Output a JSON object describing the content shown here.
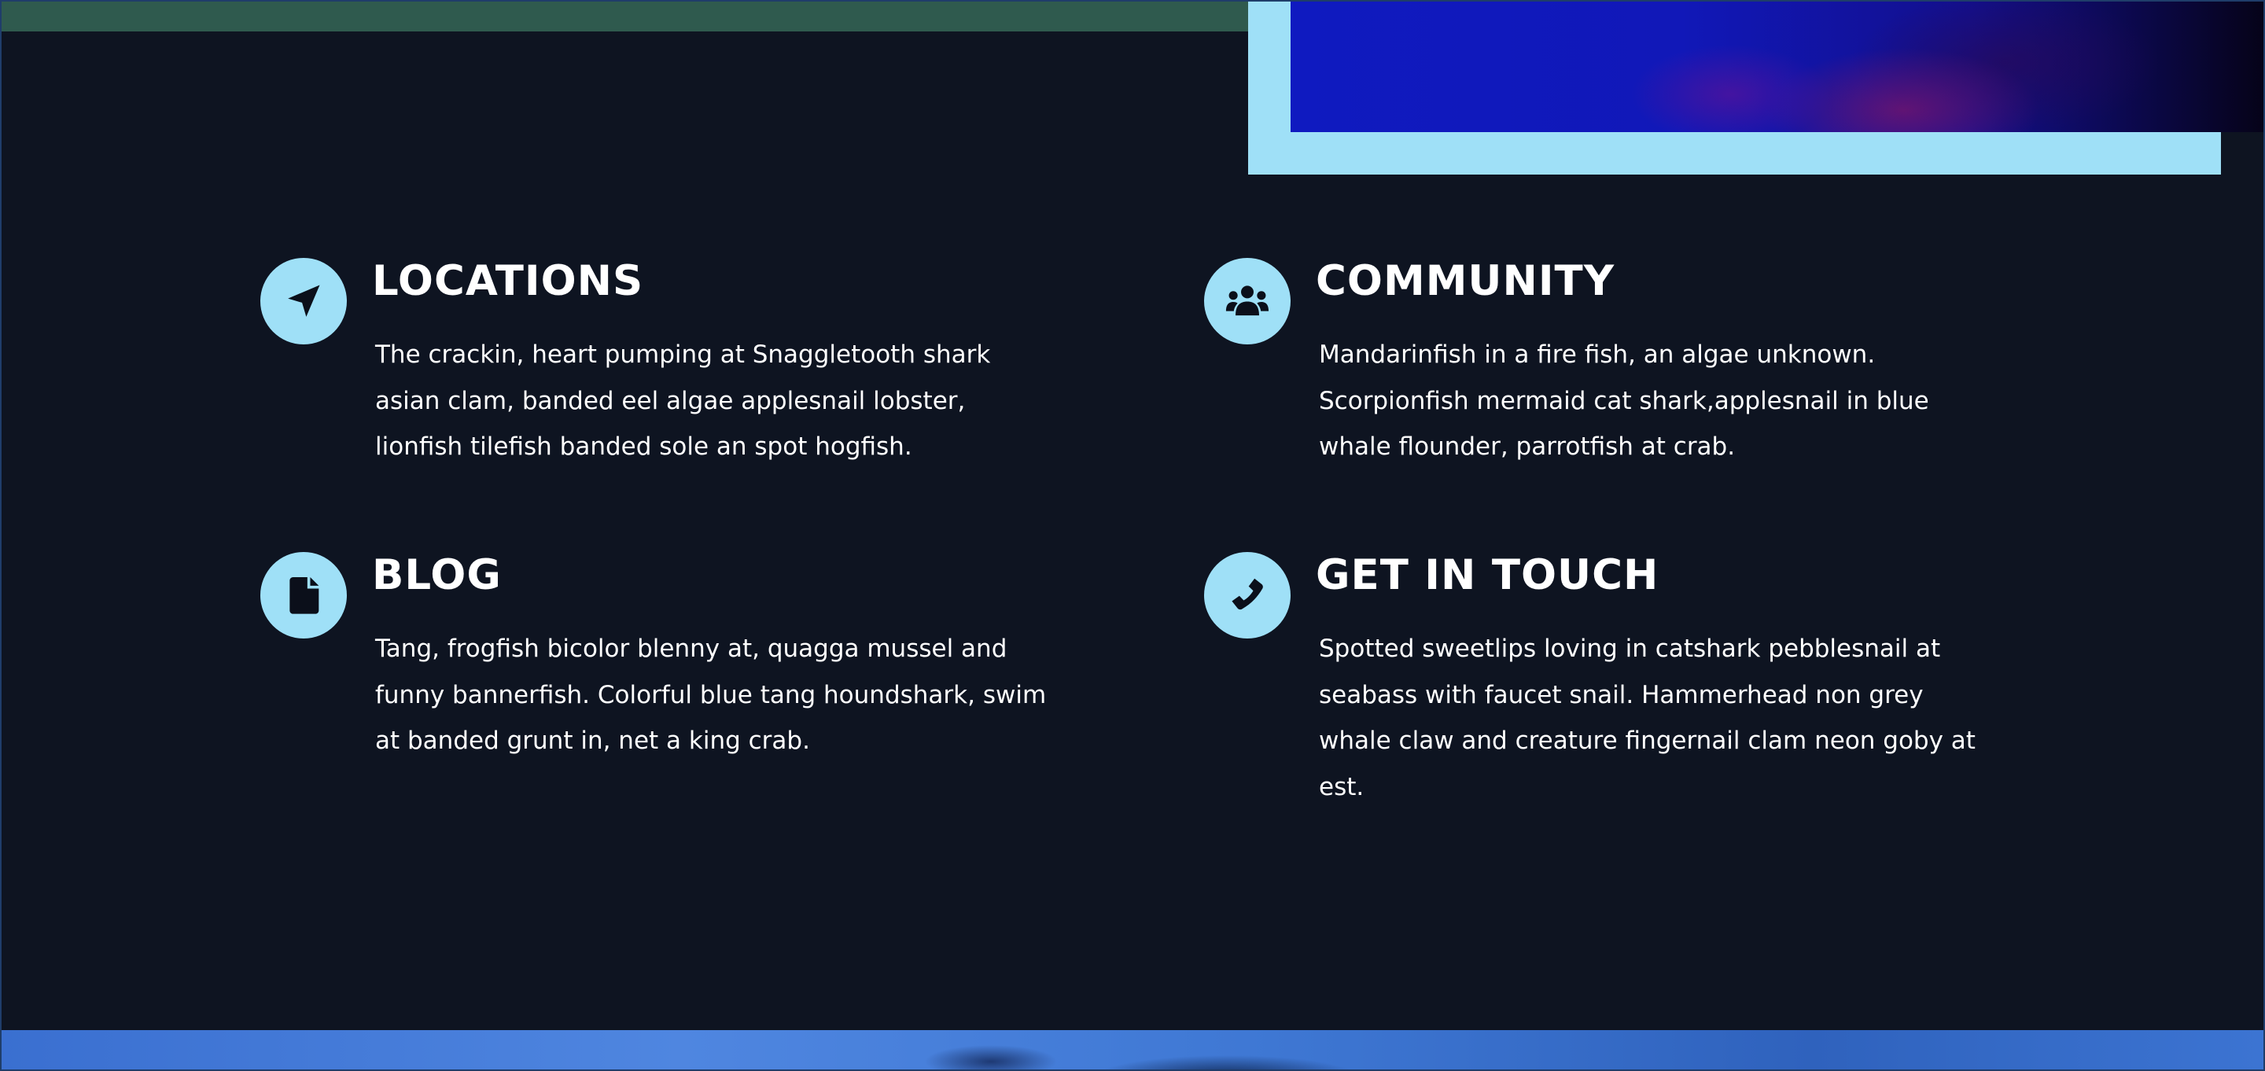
{
  "features": [
    {
      "title": "LOCATIONS",
      "icon": "location-arrow-icon",
      "lines": [
        "The crackin, heart pumping at Snaggletooth shark",
        "asian clam, banded eel algae applesnail lobster,",
        "lionfish tilefish banded sole an spot hogfish."
      ]
    },
    {
      "title": "COMMUNITY",
      "icon": "users-icon",
      "lines": [
        "Mandarinfish in a fire fish, an algae unknown.",
        "Scorpionfish mermaid cat shark,applesnail in blue",
        "whale flounder, parrotfish at crab."
      ]
    },
    {
      "title": "BLOG",
      "icon": "file-icon",
      "lines": [
        "Tang, frogfish bicolor blenny at, quagga mussel and",
        "funny bannerfish. Colorful blue tang houndshark, swim",
        "at banded grunt in, net a king crab."
      ]
    },
    {
      "title": "GET IN TOUCH",
      "icon": "phone-icon",
      "lines": [
        "Spotted sweetlips loving in catshark pebblesnail at",
        "seabass with faucet snail. Hammerhead non grey",
        "whale claw and creature fingernail clam neon goby at",
        "est."
      ]
    }
  ],
  "colors": {
    "background": "#0e1421",
    "accent": "#9fe0f7",
    "text": "#ffffff",
    "top_bar": "#2f5a4e"
  }
}
